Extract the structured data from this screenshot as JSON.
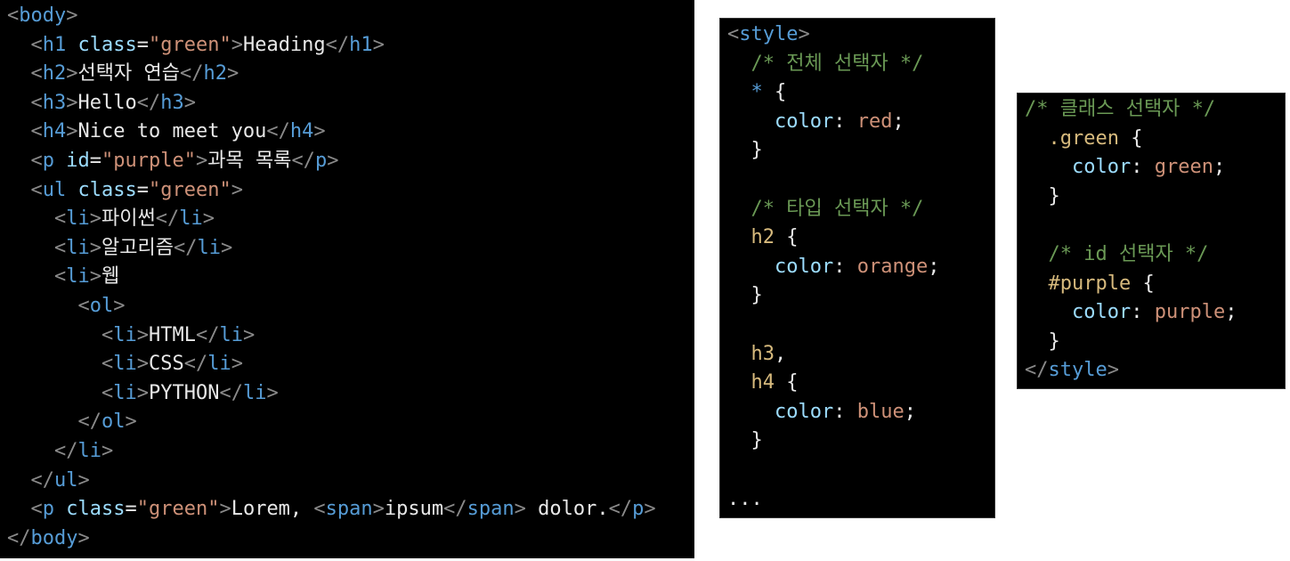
{
  "html_lines": [
    [
      [
        "br",
        "<"
      ],
      [
        "tag",
        "body"
      ],
      [
        "br",
        ">"
      ]
    ],
    [
      [
        "txt",
        "  "
      ],
      [
        "br",
        "<"
      ],
      [
        "tag",
        "h1"
      ],
      [
        "txt",
        " "
      ],
      [
        "attr",
        "class"
      ],
      [
        "txt",
        "="
      ],
      [
        "str",
        "\"green\""
      ],
      [
        "br",
        ">"
      ],
      [
        "txt",
        "Heading"
      ],
      [
        "br",
        "</"
      ],
      [
        "tag",
        "h1"
      ],
      [
        "br",
        ">"
      ]
    ],
    [
      [
        "txt",
        "  "
      ],
      [
        "br",
        "<"
      ],
      [
        "tag",
        "h2"
      ],
      [
        "br",
        ">"
      ],
      [
        "txt",
        "선택자 연습"
      ],
      [
        "br",
        "</"
      ],
      [
        "tag",
        "h2"
      ],
      [
        "br",
        ">"
      ]
    ],
    [
      [
        "txt",
        "  "
      ],
      [
        "br",
        "<"
      ],
      [
        "tag",
        "h3"
      ],
      [
        "br",
        ">"
      ],
      [
        "txt",
        "Hello"
      ],
      [
        "br",
        "</"
      ],
      [
        "tag",
        "h3"
      ],
      [
        "br",
        ">"
      ]
    ],
    [
      [
        "txt",
        "  "
      ],
      [
        "br",
        "<"
      ],
      [
        "tag",
        "h4"
      ],
      [
        "br",
        ">"
      ],
      [
        "txt",
        "Nice to meet you"
      ],
      [
        "br",
        "</"
      ],
      [
        "tag",
        "h4"
      ],
      [
        "br",
        ">"
      ]
    ],
    [
      [
        "txt",
        "  "
      ],
      [
        "br",
        "<"
      ],
      [
        "tag",
        "p"
      ],
      [
        "txt",
        " "
      ],
      [
        "attr",
        "id"
      ],
      [
        "txt",
        "="
      ],
      [
        "str",
        "\"purple\""
      ],
      [
        "br",
        ">"
      ],
      [
        "txt",
        "과목 목록"
      ],
      [
        "br",
        "</"
      ],
      [
        "tag",
        "p"
      ],
      [
        "br",
        ">"
      ]
    ],
    [
      [
        "txt",
        "  "
      ],
      [
        "br",
        "<"
      ],
      [
        "tag",
        "ul"
      ],
      [
        "txt",
        " "
      ],
      [
        "attr",
        "class"
      ],
      [
        "txt",
        "="
      ],
      [
        "str",
        "\"green\""
      ],
      [
        "br",
        ">"
      ]
    ],
    [
      [
        "txt",
        "    "
      ],
      [
        "br",
        "<"
      ],
      [
        "tag",
        "li"
      ],
      [
        "br",
        ">"
      ],
      [
        "txt",
        "파이썬"
      ],
      [
        "br",
        "</"
      ],
      [
        "tag",
        "li"
      ],
      [
        "br",
        ">"
      ]
    ],
    [
      [
        "txt",
        "    "
      ],
      [
        "br",
        "<"
      ],
      [
        "tag",
        "li"
      ],
      [
        "br",
        ">"
      ],
      [
        "txt",
        "알고리즘"
      ],
      [
        "br",
        "</"
      ],
      [
        "tag",
        "li"
      ],
      [
        "br",
        ">"
      ]
    ],
    [
      [
        "txt",
        "    "
      ],
      [
        "br",
        "<"
      ],
      [
        "tag",
        "li"
      ],
      [
        "br",
        ">"
      ],
      [
        "txt",
        "웹"
      ]
    ],
    [
      [
        "txt",
        "      "
      ],
      [
        "br",
        "<"
      ],
      [
        "tag",
        "ol"
      ],
      [
        "br",
        ">"
      ]
    ],
    [
      [
        "txt",
        "        "
      ],
      [
        "br",
        "<"
      ],
      [
        "tag",
        "li"
      ],
      [
        "br",
        ">"
      ],
      [
        "txt",
        "HTML"
      ],
      [
        "br",
        "</"
      ],
      [
        "tag",
        "li"
      ],
      [
        "br",
        ">"
      ]
    ],
    [
      [
        "txt",
        "        "
      ],
      [
        "br",
        "<"
      ],
      [
        "tag",
        "li"
      ],
      [
        "br",
        ">"
      ],
      [
        "txt",
        "CSS"
      ],
      [
        "br",
        "</"
      ],
      [
        "tag",
        "li"
      ],
      [
        "br",
        ">"
      ]
    ],
    [
      [
        "txt",
        "        "
      ],
      [
        "br",
        "<"
      ],
      [
        "tag",
        "li"
      ],
      [
        "br",
        ">"
      ],
      [
        "txt",
        "PYTHON"
      ],
      [
        "br",
        "</"
      ],
      [
        "tag",
        "li"
      ],
      [
        "br",
        ">"
      ]
    ],
    [
      [
        "txt",
        "      "
      ],
      [
        "br",
        "</"
      ],
      [
        "tag",
        "ol"
      ],
      [
        "br",
        ">"
      ]
    ],
    [
      [
        "txt",
        "    "
      ],
      [
        "br",
        "</"
      ],
      [
        "tag",
        "li"
      ],
      [
        "br",
        ">"
      ]
    ],
    [
      [
        "txt",
        "  "
      ],
      [
        "br",
        "</"
      ],
      [
        "tag",
        "ul"
      ],
      [
        "br",
        ">"
      ]
    ],
    [
      [
        "txt",
        "  "
      ],
      [
        "br",
        "<"
      ],
      [
        "tag",
        "p"
      ],
      [
        "txt",
        " "
      ],
      [
        "attr",
        "class"
      ],
      [
        "txt",
        "="
      ],
      [
        "str",
        "\"green\""
      ],
      [
        "br",
        ">"
      ],
      [
        "txt",
        "Lorem, "
      ],
      [
        "br",
        "<"
      ],
      [
        "tag",
        "span"
      ],
      [
        "br",
        ">"
      ],
      [
        "txt",
        "ipsum"
      ],
      [
        "br",
        "</"
      ],
      [
        "tag",
        "span"
      ],
      [
        "br",
        ">"
      ],
      [
        "txt",
        " dolor."
      ],
      [
        "br",
        "</"
      ],
      [
        "tag",
        "p"
      ],
      [
        "br",
        ">"
      ]
    ],
    [
      [
        "br",
        "</"
      ],
      [
        "tag",
        "body"
      ],
      [
        "br",
        ">"
      ]
    ]
  ],
  "style_lines": [
    [
      [
        "br",
        "<"
      ],
      [
        "tag",
        "style"
      ],
      [
        "br",
        ">"
      ]
    ],
    [
      [
        "txt",
        "  "
      ],
      [
        "cmt",
        "/* 전체 선택자 */"
      ]
    ],
    [
      [
        "txt",
        "  "
      ],
      [
        "uni",
        "*"
      ],
      [
        "txt",
        " {"
      ]
    ],
    [
      [
        "txt",
        "    "
      ],
      [
        "prop",
        "color"
      ],
      [
        "txt",
        ": "
      ],
      [
        "val",
        "red"
      ],
      [
        "txt",
        ";"
      ]
    ],
    [
      [
        "txt",
        "  }"
      ]
    ],
    [
      [
        "txt",
        ""
      ]
    ],
    [
      [
        "txt",
        "  "
      ],
      [
        "cmt",
        "/* 타입 선택자 */"
      ]
    ],
    [
      [
        "txt",
        "  "
      ],
      [
        "sel",
        "h2"
      ],
      [
        "txt",
        " {"
      ]
    ],
    [
      [
        "txt",
        "    "
      ],
      [
        "prop",
        "color"
      ],
      [
        "txt",
        ": "
      ],
      [
        "val",
        "orange"
      ],
      [
        "txt",
        ";"
      ]
    ],
    [
      [
        "txt",
        "  }"
      ]
    ],
    [
      [
        "txt",
        ""
      ]
    ],
    [
      [
        "txt",
        "  "
      ],
      [
        "sel",
        "h3"
      ],
      [
        "txt",
        ","
      ]
    ],
    [
      [
        "txt",
        "  "
      ],
      [
        "sel",
        "h4"
      ],
      [
        "txt",
        " {"
      ]
    ],
    [
      [
        "txt",
        "    "
      ],
      [
        "prop",
        "color"
      ],
      [
        "txt",
        ": "
      ],
      [
        "val",
        "blue"
      ],
      [
        "txt",
        ";"
      ]
    ],
    [
      [
        "txt",
        "  }"
      ]
    ],
    [
      [
        "txt",
        ""
      ]
    ],
    [
      [
        "txt",
        "..."
      ]
    ]
  ],
  "class_lines": [
    [
      [
        "cmt",
        "/* 클래스 선택자 */"
      ]
    ],
    [
      [
        "txt",
        "  "
      ],
      [
        "sel",
        ".green"
      ],
      [
        "txt",
        " {"
      ]
    ],
    [
      [
        "txt",
        "    "
      ],
      [
        "prop",
        "color"
      ],
      [
        "txt",
        ": "
      ],
      [
        "val",
        "green"
      ],
      [
        "txt",
        ";"
      ]
    ],
    [
      [
        "txt",
        "  }"
      ]
    ],
    [
      [
        "txt",
        ""
      ]
    ],
    [
      [
        "txt",
        "  "
      ],
      [
        "cmt",
        "/* id 선택자 */"
      ]
    ],
    [
      [
        "txt",
        "  "
      ],
      [
        "sel",
        "#purple"
      ],
      [
        "txt",
        " {"
      ]
    ],
    [
      [
        "txt",
        "    "
      ],
      [
        "prop",
        "color"
      ],
      [
        "txt",
        ": "
      ],
      [
        "val",
        "purple"
      ],
      [
        "txt",
        ";"
      ]
    ],
    [
      [
        "txt",
        "  }"
      ]
    ],
    [
      [
        "br",
        "</"
      ],
      [
        "tag",
        "style"
      ],
      [
        "br",
        ">"
      ]
    ]
  ]
}
